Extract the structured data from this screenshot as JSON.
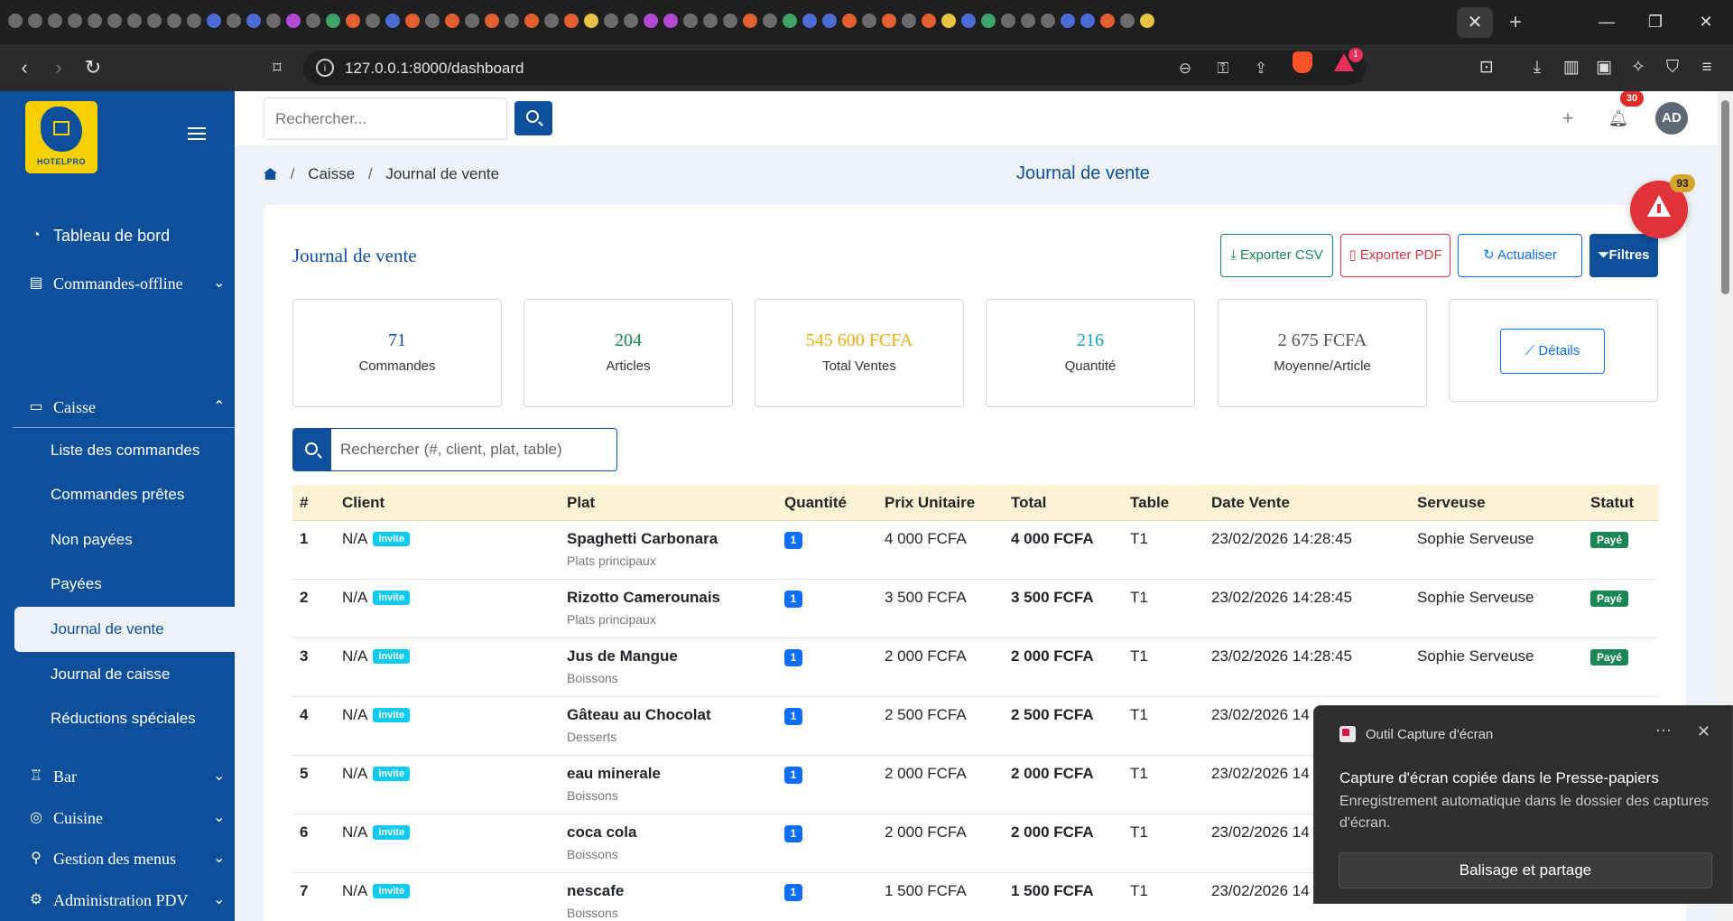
{
  "browser": {
    "url": "127.0.0.1:8000/dashboard",
    "active_tab_close": "✕",
    "new_tab": "+",
    "extension_badge": "1"
  },
  "sidebar": {
    "logo_text": "HOTELPRO",
    "items": [
      {
        "label": "Tableau de bord",
        "icon": "dashboard-icon"
      },
      {
        "label": "Commandes-offline",
        "icon": "list-icon"
      },
      {
        "label": "Caisse",
        "icon": "cash-register-icon"
      },
      {
        "label": "Bar",
        "icon": "glass-icon"
      },
      {
        "label": "Cuisine",
        "icon": "pot-icon"
      },
      {
        "label": "Gestion des menus",
        "icon": "utensils-icon"
      },
      {
        "label": "Administration PDV",
        "icon": "gear-icon"
      }
    ],
    "caisse_subitems": [
      "Liste des commandes",
      "Commandes prêtes",
      "Non payées",
      "Payées",
      "Journal de vente",
      "Journal de caisse",
      "Réductions spéciales"
    ]
  },
  "header": {
    "search_placeholder": "Rechercher...",
    "notifications_count": "30",
    "avatar_initials": "AD"
  },
  "breadcrumb": {
    "items": [
      "Caisse",
      "Journal de vente"
    ],
    "separator": "/"
  },
  "page_title": "Journal de vente",
  "card": {
    "title": "Journal de vente",
    "actions": {
      "export_csv": "Exporter CSV",
      "export_pdf": "Exporter PDF",
      "refresh": "Actualiser",
      "filters": "Filtres"
    },
    "stats": [
      {
        "value": "71",
        "label": "Commandes",
        "color": "#0e4f9c"
      },
      {
        "value": "204",
        "label": "Articles",
        "color": "#198754"
      },
      {
        "value": "545 600 FCFA",
        "label": "Total Ventes",
        "color": "#f0ad16"
      },
      {
        "value": "216",
        "label": "Quantité",
        "color": "#17a2b8"
      },
      {
        "value": "2 675 FCFA",
        "label": "Moyenne/Article",
        "color": "#555555"
      }
    ],
    "details_button": "Détails",
    "table_search_placeholder": "Rechercher (#, client, plat, table)"
  },
  "table": {
    "headers": [
      "#",
      "Client",
      "Plat",
      "Quantité",
      "Prix Unitaire",
      "Total",
      "Table",
      "Date Vente",
      "Serveuse",
      "Statut"
    ],
    "rows": [
      {
        "num": "1",
        "client": "N/A",
        "badge": "invite",
        "plat": "Spaghetti Carbonara",
        "cat": "Plats principaux",
        "qty": "1",
        "prix": "4 000 FCFA",
        "total": "4 000 FCFA",
        "table": "T1",
        "date": "23/02/2026 14:28:45",
        "serveuse": "Sophie Serveuse",
        "statut": "Payé"
      },
      {
        "num": "2",
        "client": "N/A",
        "badge": "invite",
        "plat": "Rizotto Camerounais",
        "cat": "Plats principaux",
        "qty": "1",
        "prix": "3 500 FCFA",
        "total": "3 500 FCFA",
        "table": "T1",
        "date": "23/02/2026 14:28:45",
        "serveuse": "Sophie Serveuse",
        "statut": "Payé"
      },
      {
        "num": "3",
        "client": "N/A",
        "badge": "invite",
        "plat": "Jus de Mangue",
        "cat": "Boissons",
        "qty": "1",
        "prix": "2 000 FCFA",
        "total": "2 000 FCFA",
        "table": "T1",
        "date": "23/02/2026 14:28:45",
        "serveuse": "Sophie Serveuse",
        "statut": "Payé"
      },
      {
        "num": "4",
        "client": "N/A",
        "badge": "invite",
        "plat": "Gâteau au Chocolat",
        "cat": "Desserts",
        "qty": "1",
        "prix": "2 500 FCFA",
        "total": "2 500 FCFA",
        "table": "T1",
        "date": "23/02/2026 14",
        "serveuse": "",
        "statut": ""
      },
      {
        "num": "5",
        "client": "N/A",
        "badge": "invite",
        "plat": "eau minerale",
        "cat": "Boissons",
        "qty": "1",
        "prix": "2 000 FCFA",
        "total": "2 000 FCFA",
        "table": "T1",
        "date": "23/02/2026 14",
        "serveuse": "",
        "statut": ""
      },
      {
        "num": "6",
        "client": "N/A",
        "badge": "invite",
        "plat": "coca cola",
        "cat": "Boissons",
        "qty": "1",
        "prix": "2 000 FCFA",
        "total": "2 000 FCFA",
        "table": "T1",
        "date": "23/02/2026 14",
        "serveuse": "",
        "statut": ""
      },
      {
        "num": "7",
        "client": "N/A",
        "badge": "invite",
        "plat": "nescafe",
        "cat": "Boissons",
        "qty": "1",
        "prix": "1 500 FCFA",
        "total": "1 500 FCFA",
        "table": "T1",
        "date": "23/02/2026 14",
        "serveuse": "",
        "statut": ""
      }
    ]
  },
  "alert_fab": {
    "count": "93"
  },
  "toast": {
    "app": "Outil Capture d'écran",
    "more": "···",
    "close": "✕",
    "title": "Capture d'écran copiée dans le Presse-papiers",
    "body": "Enregistrement automatique dans le dossier des captures d'écran.",
    "button": "Balisage et partage"
  }
}
